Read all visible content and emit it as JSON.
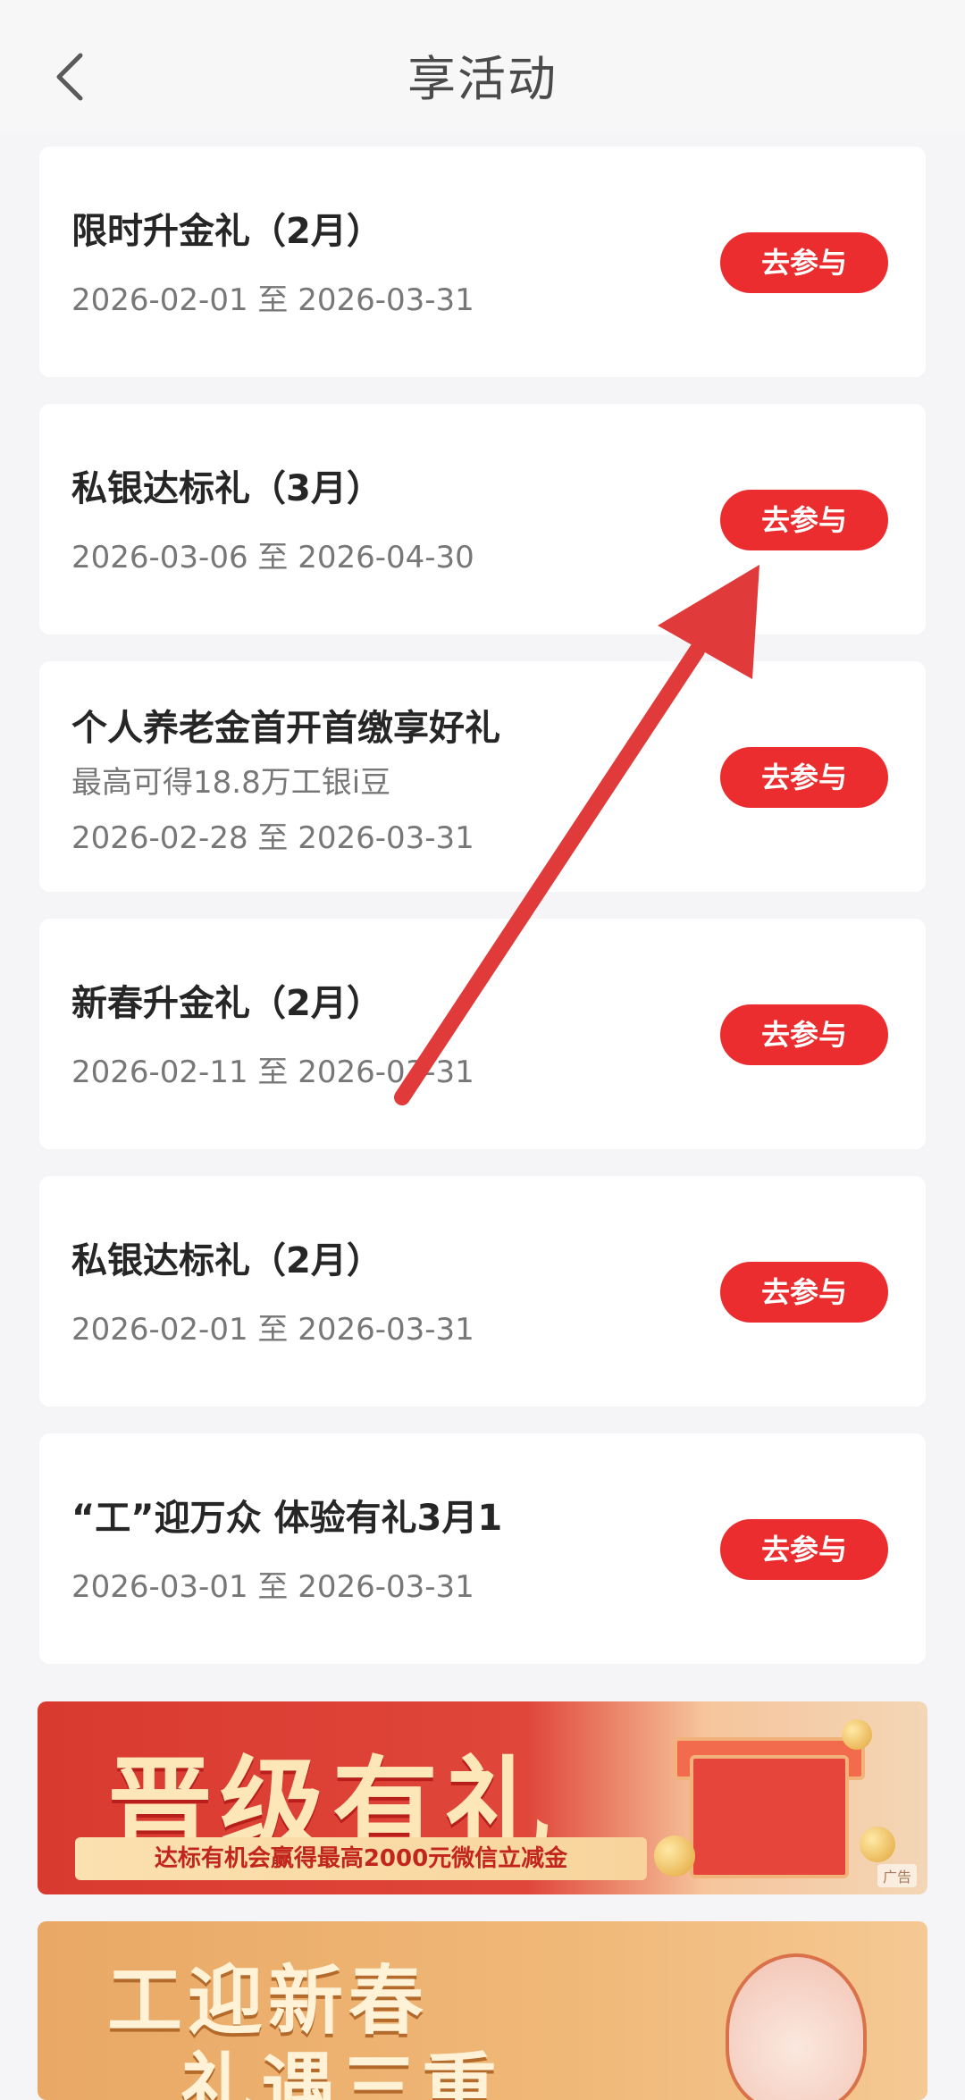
{
  "header": {
    "title": "享活动",
    "back_icon": "chevron-left-icon"
  },
  "activities": [
    {
      "title": "限时升金礼（2月）",
      "subtitle": "",
      "date": "2026-02-01 至 2026-03-31",
      "button": "去参与"
    },
    {
      "title": "私银达标礼（3月）",
      "subtitle": "",
      "date": "2026-03-06 至 2026-04-30",
      "button": "去参与"
    },
    {
      "title": "个人养老金首开首缴享好礼",
      "subtitle": "最高可得18.8万工银i豆",
      "date": "2026-02-28 至 2026-03-31",
      "button": "去参与"
    },
    {
      "title": "新春升金礼（2月）",
      "subtitle": "",
      "date": "2026-02-11 至 2026-03-31",
      "button": "去参与"
    },
    {
      "title": "私银达标礼（2月）",
      "subtitle": "",
      "date": "2026-02-01 至 2026-03-31",
      "button": "去参与"
    },
    {
      "title": "“工”迎万众 体验有礼3月1",
      "subtitle": "",
      "date": "2026-03-01 至 2026-03-31",
      "button": "去参与"
    }
  ],
  "banners": [
    {
      "headline": "晋级有礼",
      "tagline": "达标有机会赢得最高2000元微信立减金",
      "ad_label": "广告"
    },
    {
      "headline_line1": "工迎新春",
      "headline_line2": "礼遇三重"
    }
  ],
  "colors": {
    "button_red": "#ec2d2f",
    "arrow_red": "#e03a3a",
    "background": "#f5f5f7"
  }
}
